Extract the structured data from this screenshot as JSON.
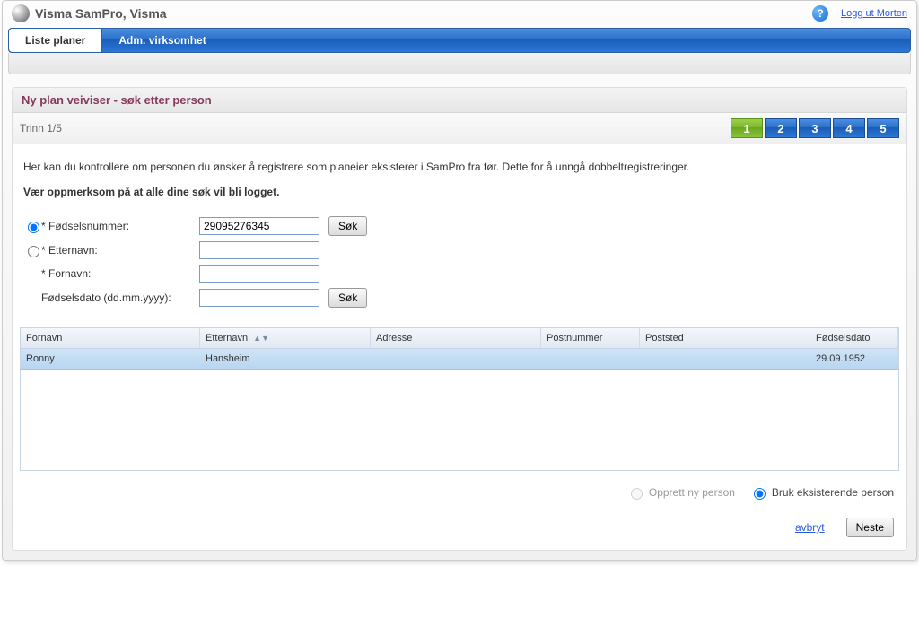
{
  "header": {
    "app_title": "Visma SamPro, Visma",
    "help_glyph": "?",
    "logout_label": "Logg ut Morten"
  },
  "tabs": {
    "active": "Liste planer",
    "other": "Adm. virksomhet"
  },
  "card": {
    "title": "Ny plan veiviser - søk etter person",
    "step_label": "Trinn 1/5",
    "steps": [
      "1",
      "2",
      "3",
      "4",
      "5"
    ]
  },
  "intro": {
    "line1": "Her kan du kontrollere om personen du ønsker å registrere som planeier eksisterer i SamPro fra før. Dette for å unngå dobbeltregistreringer.",
    "line2": "Vær oppmerksom på at alle dine søk vil bli logget."
  },
  "form": {
    "fnr_label": "* Fødselsnummer:",
    "fnr_value": "29095276345",
    "etternavn_label": "* Etternavn:",
    "etternavn_value": "",
    "fornavn_label": "* Fornavn:",
    "fornavn_value": "",
    "fdato_label": "Fødselsdato (dd.mm.yyyy):",
    "fdato_value": "",
    "sok_label": "Søk"
  },
  "results": {
    "headers": {
      "fornavn": "Fornavn",
      "etternavn": "Etternavn",
      "adresse": "Adresse",
      "postnr": "Postnummer",
      "poststed": "Poststed",
      "fdato": "Fødselsdato"
    },
    "rows": [
      {
        "fornavn": "Ronny",
        "etternavn": "Hansheim",
        "adresse": "",
        "postnr": "",
        "poststed": "",
        "fdato": "29.09.1952"
      }
    ]
  },
  "options": {
    "new_person": "Opprett ny person",
    "use_existing": "Bruk eksisterende person"
  },
  "footer": {
    "cancel": "avbryt",
    "next": "Neste"
  }
}
